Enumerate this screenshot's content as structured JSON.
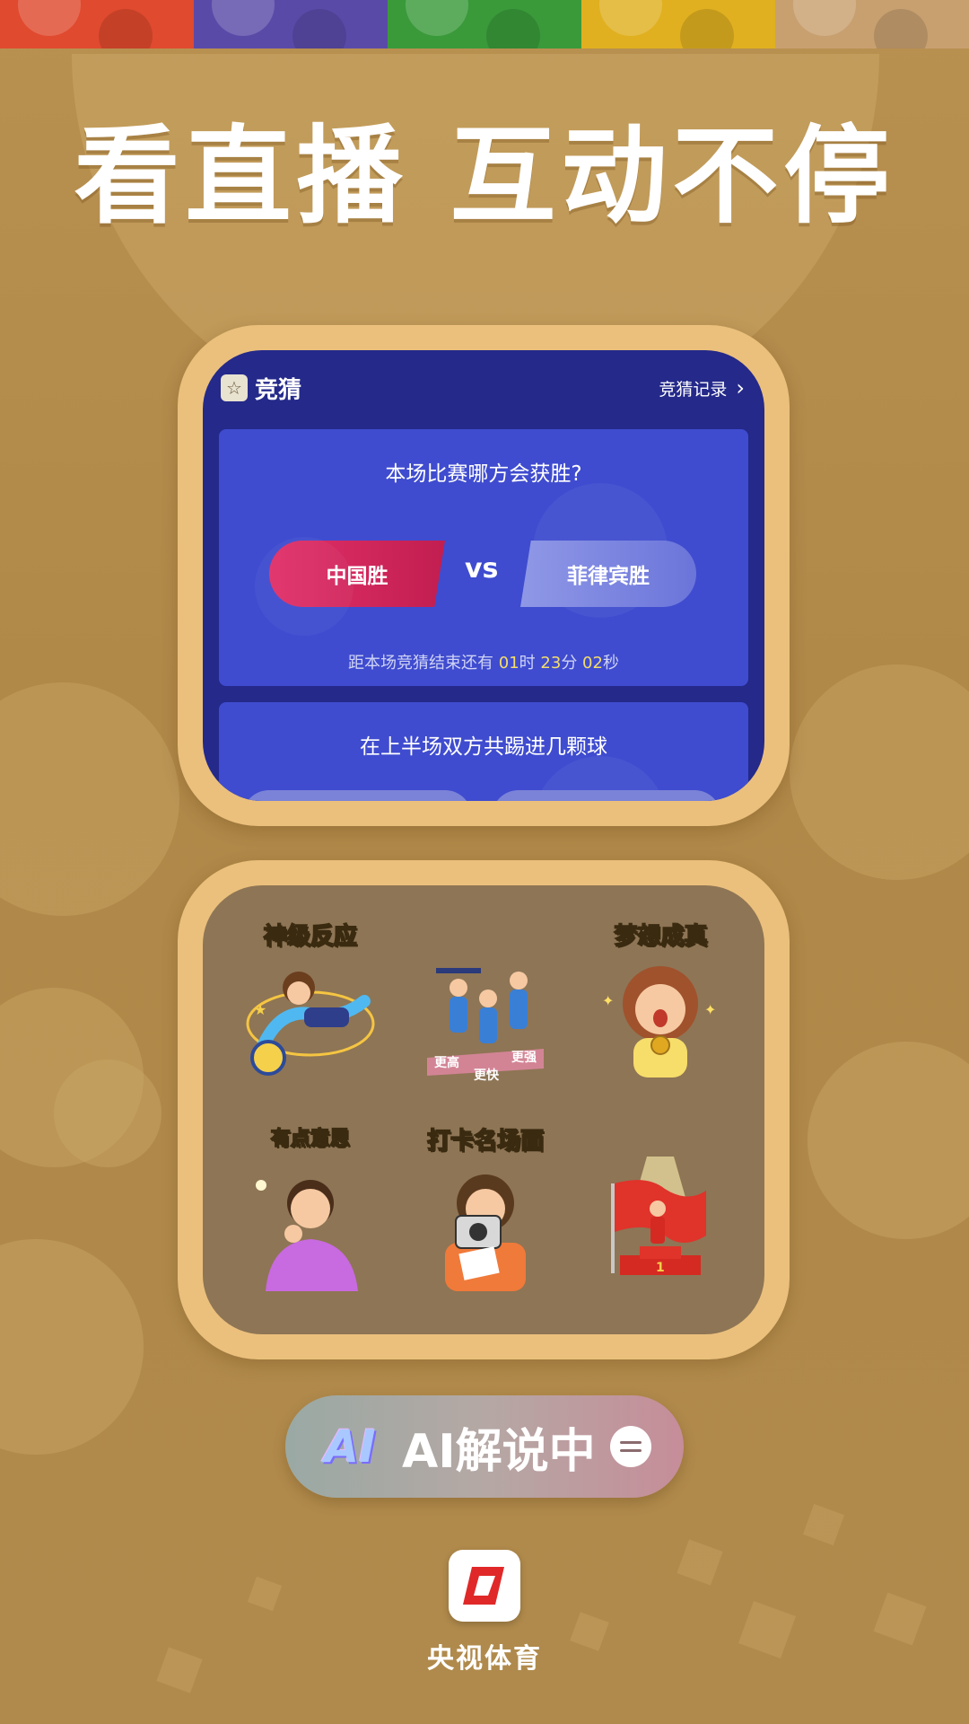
{
  "headline": "看直播 互动不停",
  "top_strip_colors": [
    "#e04a2e",
    "#5a4aa8",
    "#3a9a3a",
    "#e0b020",
    "#c8a070"
  ],
  "quiz": {
    "title": "竞猜",
    "record_link": "竞猜记录",
    "icon": "star-icon",
    "questions": [
      {
        "text": "本场比赛哪方会获胜?",
        "left_choice": "中国胜",
        "vs": "vs",
        "right_choice": "菲律宾胜",
        "countdown_prefix": "距本场竞猜结束还有",
        "hours": "01",
        "hours_unit": "时",
        "minutes": "23",
        "minutes_unit": "分",
        "seconds": "02",
        "seconds_unit": "秒"
      },
      {
        "text": "在上半场双方共踢进几颗球"
      }
    ]
  },
  "stickers": [
    {
      "caption": "神级反应",
      "icon": "diving-player-icon"
    },
    {
      "caption": "",
      "icon": "training-athletes-icon",
      "tags": [
        "更高",
        "更快",
        "更强"
      ]
    },
    {
      "caption": "梦想成真",
      "icon": "girl-with-medal-icon"
    },
    {
      "caption": "有点意思",
      "icon": "thinking-man-icon"
    },
    {
      "caption": "打卡名场面",
      "icon": "girl-with-camera-icon"
    },
    {
      "caption": "",
      "icon": "podium-flag-icon",
      "podium_number": "1"
    }
  ],
  "ai_pill": {
    "logo_text": "AI",
    "label": "AI解说中",
    "toggle_icon": "adjust-toggle-icon"
  },
  "app": {
    "name": "央视体育",
    "logo_icon": "cctv-sports-logo-icon"
  }
}
